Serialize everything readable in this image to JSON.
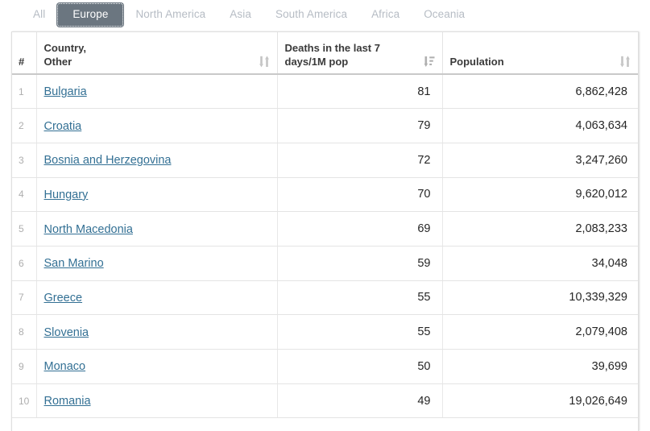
{
  "tabs": [
    {
      "label": "All",
      "active": false
    },
    {
      "label": "Europe",
      "active": true
    },
    {
      "label": "North America",
      "active": false
    },
    {
      "label": "Asia",
      "active": false
    },
    {
      "label": "South America",
      "active": false
    },
    {
      "label": "Africa",
      "active": false
    },
    {
      "label": "Oceania",
      "active": false
    }
  ],
  "table": {
    "columns": [
      {
        "key": "num",
        "label": "#",
        "sort_icon": "none",
        "align": "left"
      },
      {
        "key": "name",
        "label": "Country,\nOther",
        "sort_icon": "sort",
        "align": "left"
      },
      {
        "key": "death",
        "label": "Deaths in the last 7\ndays/1M pop",
        "sort_icon": "sort-desc",
        "align": "right"
      },
      {
        "key": "pop",
        "label": "Population",
        "sort_icon": "sort",
        "align": "right"
      }
    ],
    "rows": [
      {
        "num": "1",
        "name": "Bulgaria",
        "death": "81",
        "pop": "6,862,428"
      },
      {
        "num": "2",
        "name": "Croatia",
        "death": "79",
        "pop": "4,063,634"
      },
      {
        "num": "3",
        "name": "Bosnia and Herzegovina",
        "death": "72",
        "pop": "3,247,260"
      },
      {
        "num": "4",
        "name": "Hungary",
        "death": "70",
        "pop": "9,620,012"
      },
      {
        "num": "5",
        "name": "North Macedonia",
        "death": "69",
        "pop": "2,083,233"
      },
      {
        "num": "6",
        "name": "San Marino",
        "death": "59",
        "pop": "34,048"
      },
      {
        "num": "7",
        "name": "Greece",
        "death": "55",
        "pop": "10,339,329"
      },
      {
        "num": "8",
        "name": "Slovenia",
        "death": "55",
        "pop": "2,079,408"
      },
      {
        "num": "9",
        "name": "Monaco",
        "death": "50",
        "pop": "39,699"
      },
      {
        "num": "10",
        "name": "Romania",
        "death": "49",
        "pop": "19,026,649"
      }
    ]
  },
  "colors": {
    "active_tab_bg": "#6b7680",
    "inactive_tab_text": "#b6bcc4",
    "link": "#337094",
    "row_number": "#aeaeae",
    "sort_icon": "#c4c4c4",
    "sort_icon_active": "#b0b0b0"
  }
}
